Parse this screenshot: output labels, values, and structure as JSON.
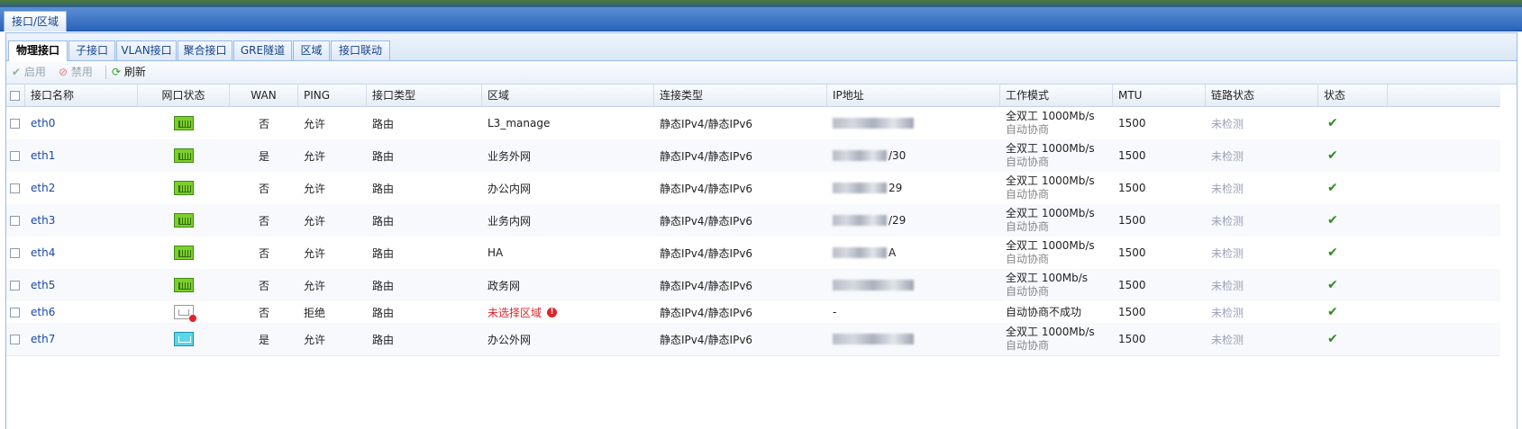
{
  "window": {
    "title_tab": "接口/区域"
  },
  "subtabs": [
    "物理接口",
    "子接口",
    "VLAN接口",
    "聚合接口",
    "GRE隧道",
    "区域",
    "接口联动"
  ],
  "toolbar": {
    "enable": "启用",
    "disable": "禁用",
    "refresh": "刷新"
  },
  "columns": [
    "接口名称",
    "网口状态",
    "WAN",
    "PING",
    "接口类型",
    "区域",
    "连接类型",
    "IP地址",
    "工作模式",
    "MTU",
    "链路状态",
    "状态"
  ],
  "rows": [
    {
      "name": "eth0",
      "port": "up",
      "wan": "否",
      "ping": "允许",
      "type": "路由",
      "zone": "L3_manage",
      "conn": "静态IPv4/静态IPv6",
      "ip": "",
      "mode": "全双工 1000Mb/s",
      "mode_sub": "自动协商",
      "mtu": "1500",
      "link": "未检测"
    },
    {
      "name": "eth1",
      "port": "up",
      "wan": "是",
      "ping": "允许",
      "type": "路由",
      "zone": "业务外网",
      "conn": "静态IPv4/静态IPv6",
      "ip": "/30",
      "mode": "全双工 1000Mb/s",
      "mode_sub": "自动协商",
      "mtu": "1500",
      "link": "未检测"
    },
    {
      "name": "eth2",
      "port": "up",
      "wan": "否",
      "ping": "允许",
      "type": "路由",
      "zone": "办公内网",
      "conn": "静态IPv4/静态IPv6",
      "ip": "29",
      "mode": "全双工 1000Mb/s",
      "mode_sub": "自动协商",
      "mtu": "1500",
      "link": "未检测"
    },
    {
      "name": "eth3",
      "port": "up",
      "wan": "否",
      "ping": "允许",
      "type": "路由",
      "zone": "业务内网",
      "conn": "静态IPv4/静态IPv6",
      "ip": "/29",
      "mode": "全双工 1000Mb/s",
      "mode_sub": "自动协商",
      "mtu": "1500",
      "link": "未检测"
    },
    {
      "name": "eth4",
      "port": "up",
      "wan": "否",
      "ping": "允许",
      "type": "路由",
      "zone": "HA",
      "conn": "静态IPv4/静态IPv6",
      "ip": "A",
      "mode": "全双工 1000Mb/s",
      "mode_sub": "自动协商",
      "mtu": "1500",
      "link": "未检测"
    },
    {
      "name": "eth5",
      "port": "up",
      "wan": "否",
      "ping": "允许",
      "type": "路由",
      "zone": "政务网",
      "conn": "静态IPv4/静态IPv6",
      "ip": "",
      "mode": "全双工 100Mb/s",
      "mode_sub": "自动协商",
      "mtu": "1500",
      "link": "未检测"
    },
    {
      "name": "eth6",
      "port": "down",
      "wan": "否",
      "ping": "拒绝",
      "type": "路由",
      "zone": "未选择区域",
      "zone_warn": true,
      "conn": "静态IPv4/静态IPv6",
      "ip": "-",
      "mode": "自动协商不成功",
      "mode_sub": "",
      "mtu": "1500",
      "link": "未检测"
    },
    {
      "name": "eth7",
      "port": "cyan",
      "wan": "是",
      "ping": "允许",
      "type": "路由",
      "zone": "办公外网",
      "conn": "静态IPv4/静态IPv6",
      "ip": "",
      "mode": "全双工 1000Mb/s",
      "mode_sub": "自动协商",
      "mtu": "1500",
      "link": "未检测"
    }
  ],
  "status_icon": "checkmark-icon",
  "colors": {
    "link": "#1b47a8",
    "warn": "#e0232a",
    "port_up": "#7ccf2b",
    "status_ok": "#2f8a1e"
  }
}
